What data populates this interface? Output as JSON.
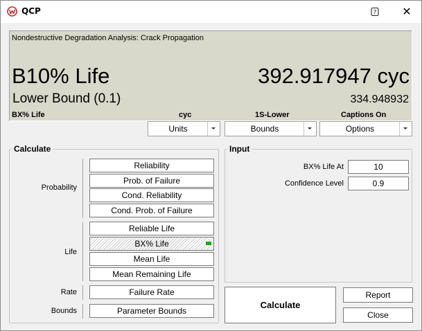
{
  "window": {
    "title": "QCP",
    "help_glyph": "?",
    "close_glyph": "✕"
  },
  "display": {
    "subtitle": "Nondestructive Degradation Analysis: Crack Propagation",
    "result_label": "B10% Life",
    "result_value": "392.917947 cyc",
    "bound_label": "Lower Bound (0.1)",
    "bound_value": "334.948932",
    "captions": [
      "BX% Life",
      "cyc",
      "1S-Lower",
      "Captions On"
    ],
    "background_color": "#d8d8cb"
  },
  "dropdowns": [
    {
      "label": "Units"
    },
    {
      "label": "Bounds"
    },
    {
      "label": "Options"
    }
  ],
  "calculate_group": {
    "title": "Calculate",
    "categories": {
      "probability": "Probability",
      "life": "Life",
      "rate": "Rate",
      "bounds": "Bounds"
    },
    "buttons": {
      "reliability": "Reliability",
      "prob_failure": "Prob. of Failure",
      "cond_reliability": "Cond. Reliability",
      "cond_prob_failure": "Cond. Prob. of Failure",
      "reliable_life": "Reliable Life",
      "bx_life": "BX% Life",
      "mean_life": "Mean Life",
      "mean_remaining_life": "Mean Remaining Life",
      "failure_rate": "Failure Rate",
      "parameter_bounds": "Parameter Bounds"
    },
    "selected": "bx_life",
    "indicator_color": "#20a020"
  },
  "input_group": {
    "title": "Input",
    "fields": [
      {
        "label": "BX% Life At",
        "value": "10"
      },
      {
        "label": "Confidence Level",
        "value": "0.9"
      }
    ]
  },
  "actions": {
    "calculate": "Calculate",
    "report": "Report",
    "close": "Close"
  },
  "icons": {
    "app": "qcp-logo-icon",
    "help": "help-icon",
    "close": "close-icon",
    "dropdown": "chevron-down-icon",
    "selected_indicator": "green-status-icon"
  }
}
